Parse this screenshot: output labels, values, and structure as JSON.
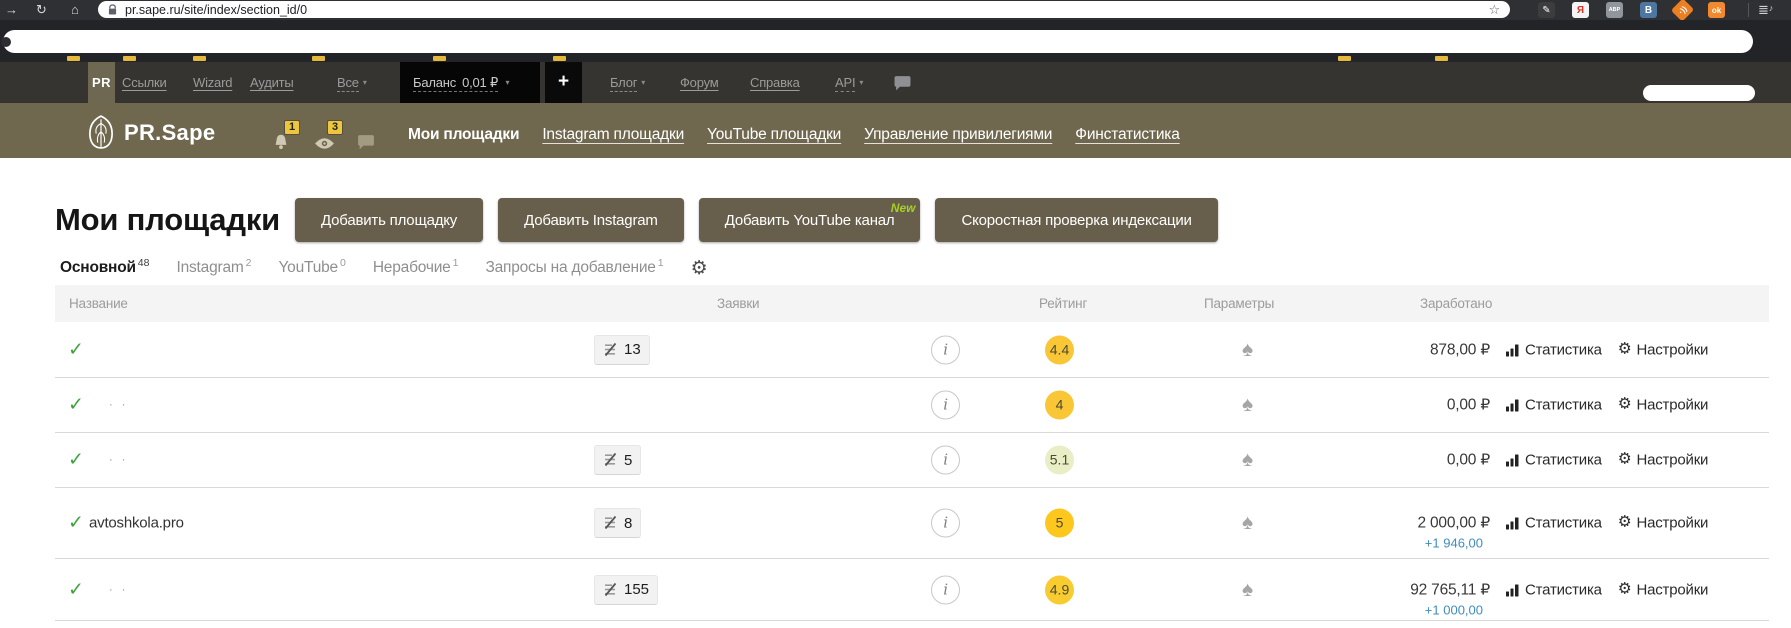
{
  "icons": {
    "forward": "→",
    "reload": "↻",
    "home": "⌂",
    "star": "☆",
    "caret": "▾",
    "check": "✓",
    "spade": "♠",
    "gear": "⚙",
    "info": "i",
    "list": "≣",
    "note": "♪",
    "plus": "+"
  },
  "colors": {
    "brand_olive": "#6f684f",
    "notification_yellow": "#eec63e",
    "new_badge_green": "#a6d025",
    "check_green": "#3aa33a",
    "positive_blue": "#3f8dbf",
    "rating_yellow": "#f9c636"
  },
  "browser": {
    "url": "pr.sape.ru/site/index/section_id/0",
    "extensions": [
      {
        "glyph": "✎",
        "style": "background:#3d3d40;color:#fff"
      },
      {
        "glyph": "Я",
        "style": "background:#f4f4f4;color:#d63228"
      },
      {
        "glyph": "ABP",
        "style": "background:#90969c;color:#fff;font-size:5.5px"
      },
      {
        "glyph": "B",
        "style": "background:#4d76a1;color:#fff"
      },
      {
        "glyph": "·))",
        "style": "background:#ec7f21;color:#fff"
      },
      {
        "glyph": "ok",
        "style": "background:#f2892e;color:#fff;font-size:8px"
      }
    ]
  },
  "top_nav": {
    "logo": "PR",
    "link_links": "Ссылки",
    "link_wizard": "Wizard",
    "link_audits": "Аудиты",
    "link_all": "Все",
    "balance_label": "Баланс",
    "balance_value": "0,01 ₽",
    "add_button": "+",
    "link_blog": "Блог",
    "link_forum": "Форум",
    "link_help": "Справка",
    "link_api": "API"
  },
  "brand_bar": {
    "logo": "PR.Sape",
    "bell_count": "1",
    "eye_count": "3",
    "links": [
      {
        "label": "Мои площадки"
      },
      {
        "label": "Instagram площадки"
      },
      {
        "label": "YouTube площадки"
      },
      {
        "label": "Управление привилегиями"
      },
      {
        "label": "Финстатистика"
      }
    ]
  },
  "main": {
    "title": "Мои площадки",
    "buttons": [
      {
        "label": "Добавить площадку"
      },
      {
        "label": "Добавить Instagram"
      },
      {
        "label": "Добавить YouTube канал",
        "badge": "New"
      },
      {
        "label": "Скоростная проверка индексации"
      }
    ],
    "tabs": [
      {
        "label": "Основной",
        "count": "48"
      },
      {
        "label": "Instagram",
        "count": "2"
      },
      {
        "label": "YouTube",
        "count": "0"
      },
      {
        "label": "Нерабочие",
        "count": "1"
      },
      {
        "label": "Запросы на добавление",
        "count": "1"
      }
    ],
    "table": {
      "headers": [
        "Название",
        "Заявки",
        "Рейтинг",
        "Параметры",
        "Заработано"
      ],
      "actions": {
        "stats": "Статистика",
        "settings": "Настройки"
      },
      "rows": [
        {
          "name": "",
          "requests": "13",
          "rating": "4.4",
          "rating_style": "background:#f9c636",
          "earned": "878,00 ₽"
        },
        {
          "name": "· ·",
          "rating": "4",
          "rating_style": "background:#f9c636",
          "earned": "0,00 ₽"
        },
        {
          "name": "· ·",
          "requests": "5",
          "rating": "5.1",
          "rating_style": "background:#eaeec6",
          "earned": "0,00 ₽"
        },
        {
          "name": "avtoshkola.pro",
          "requests": "8",
          "rating": "5",
          "rating_style": "background:#fdc71d",
          "earned": "2 000,00 ₽",
          "earned_extra": "+1 946,00"
        },
        {
          "name": "· ·",
          "requests": "155",
          "rating": "4.9",
          "rating_style": "background:#f8cb31",
          "earned": "92 765,11 ₽",
          "earned_extra": "+1 000,00"
        }
      ]
    }
  }
}
